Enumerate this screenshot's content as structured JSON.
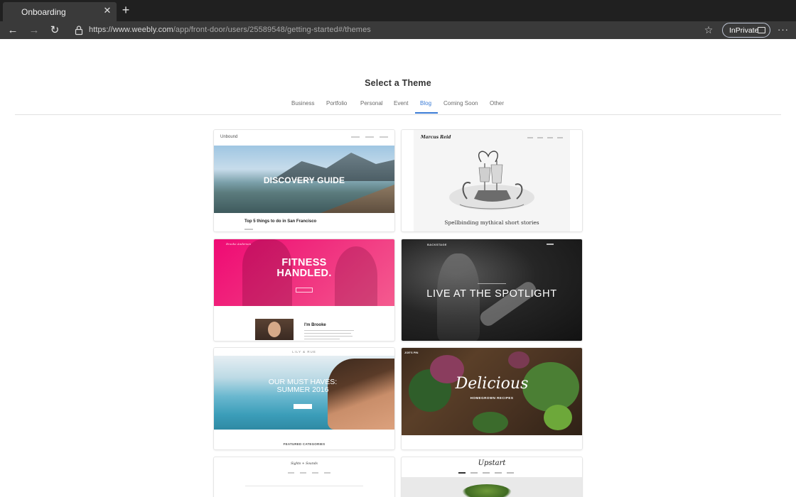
{
  "browser": {
    "tab_title": "Onboarding",
    "url_host": "https://www.weebly.com",
    "url_path": "/app/front-door/users/25589548/getting-started#/themes",
    "inprivate_label": "InPrivate"
  },
  "page": {
    "title": "Select a Theme",
    "tabs": [
      "Business",
      "Portfolio",
      "Personal",
      "Event",
      "Blog",
      "Coming Soon",
      "Other"
    ],
    "active_tab": "Blog"
  },
  "themes": {
    "unbound": {
      "logo": "Unbound",
      "hero_text": "DISCOVERY GUIDE",
      "caption": "Top 5 things to do in San Francisco"
    },
    "marcus_reid": {
      "logo": "Marcus Reid",
      "caption": "Spellbinding mythical short stories"
    },
    "fitness": {
      "hero_text_line1": "FITNESS",
      "hero_text_line2": "HANDLED.",
      "name": "I'm Brooke"
    },
    "backstage": {
      "brand": "BACKSTAGE",
      "hero_text": "LIVE AT THE SPOTLIGHT"
    },
    "lily_rue": {
      "logo": "LILY & RUE",
      "hero_text_line1": "OUR MUST HAVES:",
      "hero_text_line2": "SUMMER 2016",
      "featured": "FEATURED CATEGORIES"
    },
    "delicious": {
      "hero_text": "Delicious",
      "sub_text": "HOMEGROWN RECIPES"
    },
    "sights_sounds": {
      "title": "Sights + Sounds"
    },
    "upstart": {
      "title": "Upstart"
    }
  },
  "colors": {
    "accent": "#3a7bd5",
    "fitness_pink": "#ef0a74"
  }
}
